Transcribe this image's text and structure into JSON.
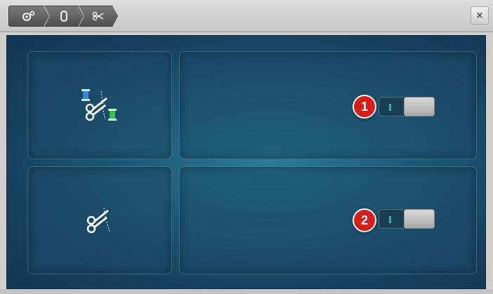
{
  "header": {
    "breadcrumbs": [
      {
        "icon": "settings-machine-icon"
      },
      {
        "icon": "presser-foot-icon"
      },
      {
        "icon": "scissors-icon"
      }
    ],
    "close_icon": "close-icon",
    "close_label": "×"
  },
  "settings": [
    {
      "icon": "thread-cutter-auto-icon",
      "toggle_state": "off",
      "badge": "1"
    },
    {
      "icon": "thread-cut-icon",
      "toggle_state": "off",
      "badge": "2"
    }
  ],
  "colors": {
    "panel_bg": "#1d5d78",
    "badge": "#d61f1a",
    "toggle_knob": "#c0c0c0",
    "toggle_accent": "#3fa9b4"
  }
}
